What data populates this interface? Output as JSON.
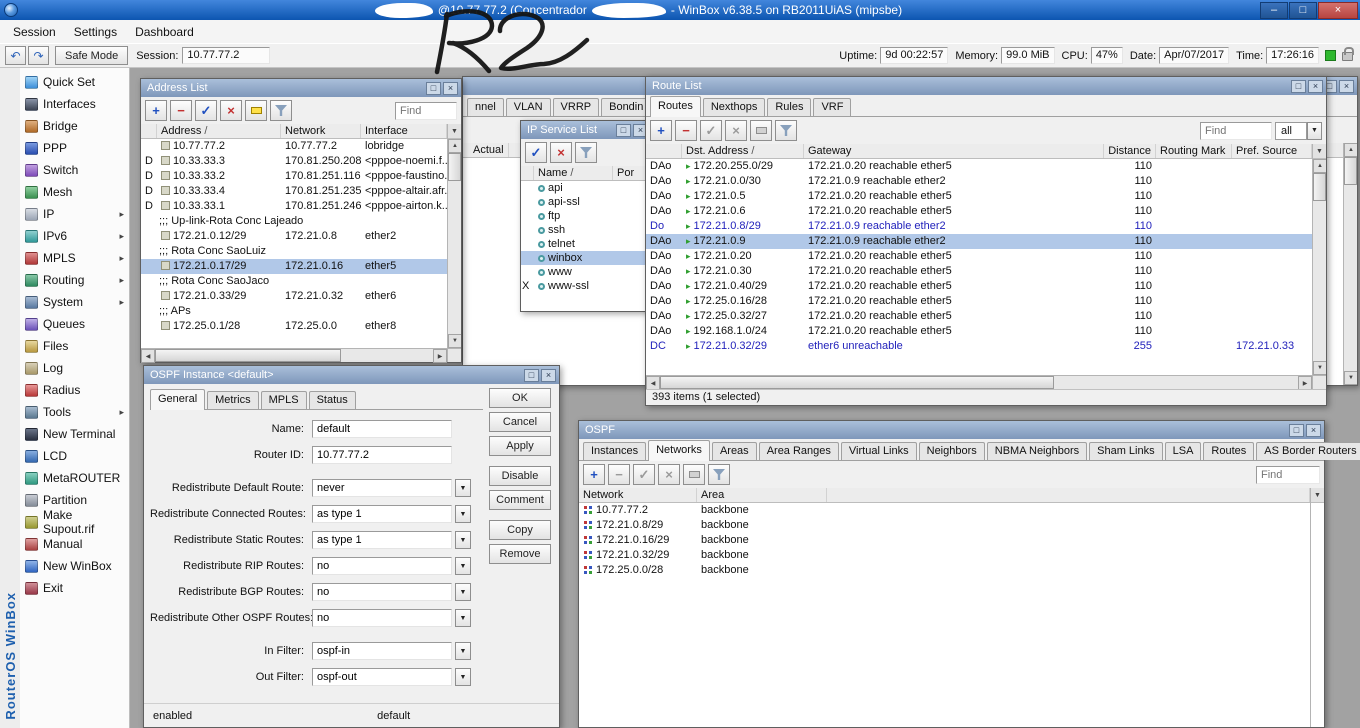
{
  "icons": {
    "minimize": "–",
    "maximize": "□",
    "close": "×",
    "undo": "↶",
    "redo": "↷",
    "plus": "+",
    "minus": "−",
    "check": "✓",
    "cross": "×",
    "dropdown": "▼",
    "sort": "/",
    "up": "▲",
    "down": "▼",
    "left": "◀",
    "right": "▶",
    "route_state": "▸"
  },
  "titlebar": {
    "title_left": "@10.77.77.2 (Concentrador",
    "title_right": "- WinBox v6.38.5 on RB2011UiAS (mipsbe)"
  },
  "menubar": {
    "items": [
      {
        "label": "Session"
      },
      {
        "label": "Settings"
      },
      {
        "label": "Dashboard"
      }
    ]
  },
  "toolbar": {
    "safe_mode_label": "Safe Mode",
    "session_label": "Session:",
    "session_value": "10.77.77.2",
    "stats": [
      {
        "label": "Uptime:",
        "value": "9d 00:22:57"
      },
      {
        "label": "Memory:",
        "value": "99.0 MiB"
      },
      {
        "label": "CPU:",
        "value": "47%"
      },
      {
        "label": "Date:",
        "value": "Apr/07/2017"
      },
      {
        "label": "Time:",
        "value": "17:26:16"
      }
    ]
  },
  "brand": "RouterOS WinBox",
  "annotation": {
    "text": "R2"
  },
  "sidebar": {
    "items": [
      {
        "label": "Quick Set",
        "icon": "quickset-icon"
      },
      {
        "label": "Interfaces",
        "icon": "interfaces-icon"
      },
      {
        "label": "Bridge",
        "icon": "bridge-icon"
      },
      {
        "label": "PPP",
        "icon": "ppp-icon"
      },
      {
        "label": "Switch",
        "icon": "switch-icon"
      },
      {
        "label": "Mesh",
        "icon": "mesh-icon"
      },
      {
        "label": "IP",
        "icon": "ip-icon",
        "arrow": "▸"
      },
      {
        "label": "IPv6",
        "icon": "ipv6-icon",
        "arrow": "▸"
      },
      {
        "label": "MPLS",
        "icon": "mpls-icon",
        "arrow": "▸"
      },
      {
        "label": "Routing",
        "icon": "routing-icon",
        "arrow": "▸"
      },
      {
        "label": "System",
        "icon": "system-icon",
        "arrow": "▸"
      },
      {
        "label": "Queues",
        "icon": "queues-icon"
      },
      {
        "label": "Files",
        "icon": "files-icon"
      },
      {
        "label": "Log",
        "icon": "log-icon"
      },
      {
        "label": "Radius",
        "icon": "radius-icon"
      },
      {
        "label": "Tools",
        "icon": "tools-icon",
        "arrow": "▸"
      },
      {
        "label": "New Terminal",
        "icon": "terminal-icon"
      },
      {
        "label": "LCD",
        "icon": "lcd-icon"
      },
      {
        "label": "MetaROUTER",
        "icon": "metarouter-icon"
      },
      {
        "label": "Partition",
        "icon": "partition-icon"
      },
      {
        "label": "Make Supout.rif",
        "icon": "supout-icon"
      },
      {
        "label": "Manual",
        "icon": "manual-icon"
      },
      {
        "label": "New WinBox",
        "icon": "newwinbox-icon"
      },
      {
        "label": "Exit",
        "icon": "exit-icon"
      }
    ]
  },
  "interface_list": {
    "title": "",
    "tabs": [
      {
        "label": "nnel"
      },
      {
        "label": "VLAN"
      },
      {
        "label": "VRRP"
      },
      {
        "label": "Bondin"
      }
    ],
    "column_actual": "Actual"
  },
  "address_list": {
    "title": "Address List",
    "find_placeholder": "Find",
    "columns": {
      "address": "Address",
      "network": "Network",
      "interface": "Interface"
    },
    "rows": [
      {
        "flag": "",
        "address": "10.77.77.2",
        "network": "10.77.77.2",
        "iface": "lobridge"
      },
      {
        "flag": "D",
        "address": "10.33.33.3",
        "network": "170.81.250.208",
        "iface": "<pppoe-noemi.f..."
      },
      {
        "flag": "D",
        "address": "10.33.33.2",
        "network": "170.81.251.116",
        "iface": "<pppoe-faustino..."
      },
      {
        "flag": "D",
        "address": "10.33.33.4",
        "network": "170.81.251.235",
        "iface": "<pppoe-altair.afr..."
      },
      {
        "flag": "D",
        "address": "10.33.33.1",
        "network": "170.81.251.246",
        "iface": "<pppoe-airton.k..."
      },
      {
        "comment": ";;; Up-link-Rota Conc Lajeado",
        "_cls": "comment"
      },
      {
        "flag": "",
        "address": "172.21.0.12/29",
        "network": "172.21.0.8",
        "iface": "ether2"
      },
      {
        "comment": ";;; Rota Conc SaoLuiz",
        "_cls": "comment"
      },
      {
        "flag": "",
        "address": "172.21.0.17/29",
        "network": "172.21.0.16",
        "iface": "ether5",
        "_cls": "selected"
      },
      {
        "comment": ";;; Rota Conc SaoJaco",
        "_cls": "comment"
      },
      {
        "flag": "",
        "address": "172.21.0.33/29",
        "network": "172.21.0.32",
        "iface": "ether6"
      },
      {
        "comment": ";;; APs",
        "_cls": "comment"
      },
      {
        "flag": "",
        "address": "172.25.0.1/28",
        "network": "172.25.0.0",
        "iface": "ether8"
      }
    ]
  },
  "ip_service_list": {
    "title": "IP Service List",
    "columns": {
      "name": "Name",
      "port": "Por"
    },
    "rows": [
      {
        "flag": "",
        "name": "api"
      },
      {
        "flag": "",
        "name": "api-ssl"
      },
      {
        "flag": "",
        "name": "ftp"
      },
      {
        "flag": "",
        "name": "ssh"
      },
      {
        "flag": "",
        "name": "telnet"
      },
      {
        "flag": "",
        "name": "winbox",
        "_cls": "selected"
      },
      {
        "flag": "",
        "name": "www"
      },
      {
        "flag": "X",
        "name": "www-ssl"
      }
    ]
  },
  "route_list": {
    "title": "Route List",
    "tabs": [
      {
        "label": "Routes",
        "_cls": "active"
      },
      {
        "label": "Nexthops"
      },
      {
        "label": "Rules"
      },
      {
        "label": "VRF"
      }
    ],
    "find_placeholder": "Find",
    "scope": "all",
    "columns": {
      "dst": "Dst. Address",
      "gateway": "Gateway",
      "distance": "Distance",
      "routing_mark": "Routing Mark",
      "pref_source": "Pref. Source"
    },
    "rows": [
      {
        "flags": "DAo",
        "dst": "172.20.255.0/29",
        "gw": "172.21.0.20 reachable ether5",
        "dist": "110",
        "mark": "",
        "pref": ""
      },
      {
        "flags": "DAo",
        "dst": "172.21.0.0/30",
        "gw": "172.21.0.9 reachable ether2",
        "dist": "110",
        "mark": "",
        "pref": ""
      },
      {
        "flags": "DAo",
        "dst": "172.21.0.5",
        "gw": "172.21.0.20 reachable ether5",
        "dist": "110",
        "mark": "",
        "pref": ""
      },
      {
        "flags": "DAo",
        "dst": "172.21.0.6",
        "gw": "172.21.0.20 reachable ether5",
        "dist": "110",
        "mark": "",
        "pref": ""
      },
      {
        "flags": "Do",
        "dst": "172.21.0.8/29",
        "gw": "172.21.0.9 reachable ether2",
        "dist": "110",
        "mark": "",
        "pref": "",
        "_cls": "blue"
      },
      {
        "flags": "DAo",
        "dst": "172.21.0.9",
        "gw": "172.21.0.9 reachable ether2",
        "dist": "110",
        "mark": "",
        "pref": "",
        "_cls": "selected"
      },
      {
        "flags": "DAo",
        "dst": "172.21.0.20",
        "gw": "172.21.0.20 reachable ether5",
        "dist": "110",
        "mark": "",
        "pref": ""
      },
      {
        "flags": "DAo",
        "dst": "172.21.0.30",
        "gw": "172.21.0.20 reachable ether5",
        "dist": "110",
        "mark": "",
        "pref": ""
      },
      {
        "flags": "DAo",
        "dst": "172.21.0.40/29",
        "gw": "172.21.0.20 reachable ether5",
        "dist": "110",
        "mark": "",
        "pref": ""
      },
      {
        "flags": "DAo",
        "dst": "172.25.0.16/28",
        "gw": "172.21.0.20 reachable ether5",
        "dist": "110",
        "mark": "",
        "pref": ""
      },
      {
        "flags": "DAo",
        "dst": "172.25.0.32/27",
        "gw": "172.21.0.20 reachable ether5",
        "dist": "110",
        "mark": "",
        "pref": ""
      },
      {
        "flags": "DAo",
        "dst": "192.168.1.0/24",
        "gw": "172.21.0.20 reachable ether5",
        "dist": "110",
        "mark": "",
        "pref": ""
      },
      {
        "flags": "DC",
        "dst": "172.21.0.32/29",
        "gw": "ether6 unreachable",
        "dist": "255",
        "mark": "",
        "pref": "172.21.0.33",
        "_cls": "blue"
      }
    ],
    "status": "393 items (1 selected)"
  },
  "ospf_instance": {
    "title": "OSPF Instance <default>",
    "tabs": [
      {
        "label": "General",
        "_cls": "active"
      },
      {
        "label": "Metrics"
      },
      {
        "label": "MPLS"
      },
      {
        "label": "Status"
      }
    ],
    "buttons": [
      {
        "label": "OK"
      },
      {
        "label": "Cancel"
      },
      {
        "label": "Apply"
      },
      {
        "label": "Disable",
        "_cls": "gap"
      },
      {
        "label": "Comment"
      },
      {
        "label": "Copy",
        "_cls": "gap"
      },
      {
        "label": "Remove"
      }
    ],
    "fields": [
      {
        "label": "Name:",
        "value": "default"
      },
      {
        "label": "Router ID:",
        "value": "10.77.77.2"
      },
      {
        "label": "Redistribute Default Route:",
        "value": "never",
        "_cls": "combo gap"
      },
      {
        "label": "Redistribute Connected Routes:",
        "value": "as type 1",
        "_cls": "combo"
      },
      {
        "label": "Redistribute Static Routes:",
        "value": "as type 1",
        "_cls": "combo"
      },
      {
        "label": "Redistribute RIP Routes:",
        "value": "no",
        "_cls": "combo"
      },
      {
        "label": "Redistribute BGP Routes:",
        "value": "no",
        "_cls": "combo"
      },
      {
        "label": "Redistribute Other OSPF Routes:",
        "value": "no",
        "_cls": "combo"
      },
      {
        "label": "In Filter:",
        "value": "ospf-in",
        "_cls": "combo gap"
      },
      {
        "label": "Out Filter:",
        "value": "ospf-out",
        "_cls": "combo"
      }
    ],
    "status_left": "enabled",
    "status_right": "default"
  },
  "ospf": {
    "title": "OSPF",
    "find_placeholder": "Find",
    "tabs": [
      {
        "label": "Instances"
      },
      {
        "label": "Networks",
        "_cls": "active"
      },
      {
        "label": "Areas"
      },
      {
        "label": "Area Ranges"
      },
      {
        "label": "Virtual Links"
      },
      {
        "label": "Neighbors"
      },
      {
        "label": "NBMA Neighbors"
      },
      {
        "label": "Sham Links"
      },
      {
        "label": "LSA"
      },
      {
        "label": "Routes"
      },
      {
        "label": "AS Border Routers"
      },
      {
        "label": "..."
      }
    ],
    "columns": {
      "network": "Network",
      "area": "Area"
    },
    "rows": [
      {
        "network": "10.77.77.2",
        "area": "backbone"
      },
      {
        "network": "172.21.0.8/29",
        "area": "backbone"
      },
      {
        "network": "172.21.0.16/29",
        "area": "backbone"
      },
      {
        "network": "172.21.0.32/29",
        "area": "backbone"
      },
      {
        "network": "172.25.0.0/28",
        "area": "backbone"
      }
    ]
  }
}
